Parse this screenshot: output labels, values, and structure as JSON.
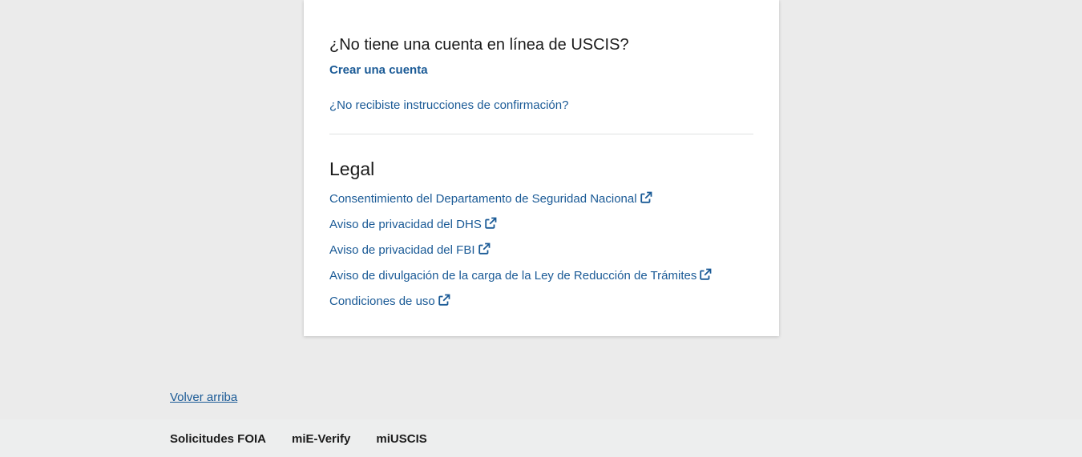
{
  "account": {
    "heading": "¿No tiene una cuenta en línea de USCIS?",
    "create_link": "Crear una cuenta",
    "confirm_link": "¿No recibiste instrucciones de confirmación?"
  },
  "legal": {
    "heading": "Legal",
    "links": [
      {
        "label": "Consentimiento del Departamento de Seguridad Nacional",
        "icon": "external-link-icon"
      },
      {
        "label": "Aviso de privacidad del DHS",
        "icon": "external-link-icon"
      },
      {
        "label": "Aviso de privacidad del FBI",
        "icon": "external-link-icon"
      },
      {
        "label": "Aviso de divulgación de la carga de la Ley de Reducción de Trámites",
        "icon": "external-link-icon"
      },
      {
        "label": "Condiciones de uso",
        "icon": "external-link-icon"
      }
    ]
  },
  "back_to_top": "Volver arriba",
  "footer": {
    "links": [
      {
        "label": "Solicitudes FOIA"
      },
      {
        "label": "miE-Verify"
      },
      {
        "label": "miUSCIS"
      }
    ]
  },
  "colors": {
    "link": "#1a5a96",
    "page_background": "#ebebeb",
    "card_background": "#ffffff",
    "footer_background": "#edeeee",
    "text": "#1b1b1b"
  }
}
